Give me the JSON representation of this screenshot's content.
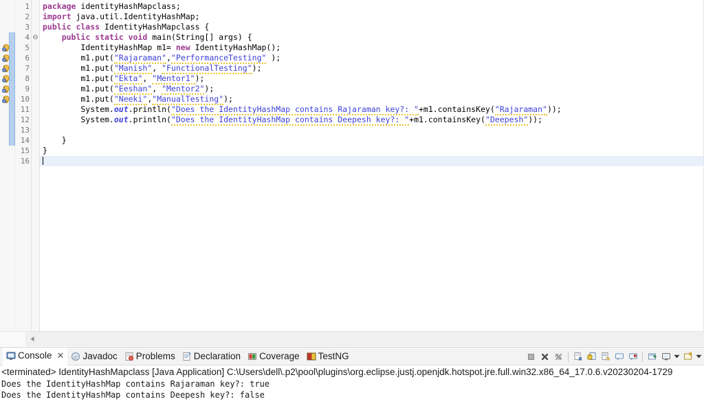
{
  "editor": {
    "lines": [
      {
        "num": "1",
        "fold": "",
        "marker": "none",
        "changed": false,
        "tokens": [
          {
            "t": "kw",
            "s": "package"
          },
          {
            "t": "plain",
            "s": " identityHashMapclass;"
          }
        ]
      },
      {
        "num": "2",
        "fold": "",
        "marker": "none",
        "changed": false,
        "tokens": [
          {
            "t": "kw",
            "s": "import"
          },
          {
            "t": "plain",
            "s": " java.util.IdentityHashMap;"
          }
        ]
      },
      {
        "num": "3",
        "fold": "",
        "marker": "none",
        "changed": false,
        "tokens": [
          {
            "t": "kw",
            "s": "public class"
          },
          {
            "t": "plain",
            "s": " IdentityHashMapclass {"
          }
        ]
      },
      {
        "num": "4",
        "fold": "⊖",
        "marker": "none",
        "changed": true,
        "tokens": [
          {
            "t": "plain",
            "s": "    "
          },
          {
            "t": "kw",
            "s": "public static void"
          },
          {
            "t": "plain",
            "s": " main(String[] args) {"
          }
        ]
      },
      {
        "num": "5",
        "fold": "",
        "marker": "bulb",
        "changed": true,
        "tokens": [
          {
            "t": "plain",
            "s": "        IdentityHashMap m1= "
          },
          {
            "t": "kw",
            "s": "new"
          },
          {
            "t": "plain",
            "s": " IdentityHashMap();"
          }
        ]
      },
      {
        "num": "6",
        "fold": "",
        "marker": "bulb",
        "changed": true,
        "tokens": [
          {
            "t": "plain",
            "s": "        m1.put("
          },
          {
            "t": "str",
            "s": "\"Rajaraman\""
          },
          {
            "t": "plain",
            "s": ","
          },
          {
            "t": "str",
            "s": "\"PerformanceTesting\""
          },
          {
            "t": "plain",
            "s": " );"
          }
        ]
      },
      {
        "num": "7",
        "fold": "",
        "marker": "bulb",
        "changed": true,
        "tokens": [
          {
            "t": "plain",
            "s": "        m1.put("
          },
          {
            "t": "str",
            "s": "\"Manish\""
          },
          {
            "t": "plain",
            "s": ", "
          },
          {
            "t": "str",
            "s": "\"FunctionalTesting\""
          },
          {
            "t": "plain",
            "s": ");"
          }
        ]
      },
      {
        "num": "8",
        "fold": "",
        "marker": "bulb",
        "changed": true,
        "tokens": [
          {
            "t": "plain",
            "s": "        m1.put("
          },
          {
            "t": "str",
            "s": "\"Ekta\""
          },
          {
            "t": "plain",
            "s": ", "
          },
          {
            "t": "str",
            "s": "\"Mentor1\""
          },
          {
            "t": "plain",
            "s": ");"
          }
        ]
      },
      {
        "num": "9",
        "fold": "",
        "marker": "bulb",
        "changed": true,
        "tokens": [
          {
            "t": "plain",
            "s": "        m1.put("
          },
          {
            "t": "str",
            "s": "\"Eeshan\""
          },
          {
            "t": "plain",
            "s": ", "
          },
          {
            "t": "str",
            "s": "\"Mentor2\""
          },
          {
            "t": "plain",
            "s": ");"
          }
        ]
      },
      {
        "num": "10",
        "fold": "",
        "marker": "bulb",
        "changed": true,
        "tokens": [
          {
            "t": "plain",
            "s": "        m1.put("
          },
          {
            "t": "str",
            "s": "\"Neeki\""
          },
          {
            "t": "plain",
            "s": ","
          },
          {
            "t": "str",
            "s": "\"ManualTesting\""
          },
          {
            "t": "plain",
            "s": ");"
          }
        ]
      },
      {
        "num": "11",
        "fold": "",
        "marker": "none",
        "changed": true,
        "tokens": [
          {
            "t": "plain",
            "s": "        System."
          },
          {
            "t": "fld",
            "s": "out"
          },
          {
            "t": "plain",
            "s": ".println("
          },
          {
            "t": "str",
            "s": "\"Does the IdentityHashMap contains Rajaraman key?: \""
          },
          {
            "t": "plain",
            "s": "+m1.containsKey("
          },
          {
            "t": "str",
            "s": "\"Rajaraman\""
          },
          {
            "t": "plain",
            "s": "));"
          }
        ]
      },
      {
        "num": "12",
        "fold": "",
        "marker": "none",
        "changed": true,
        "tokens": [
          {
            "t": "plain",
            "s": "        System."
          },
          {
            "t": "fld",
            "s": "out"
          },
          {
            "t": "plain",
            "s": ".println("
          },
          {
            "t": "str",
            "s": "\"Does the IdentityHashMap contains Deepesh key?: \""
          },
          {
            "t": "plain",
            "s": "+m1.containsKey("
          },
          {
            "t": "str",
            "s": "\"Deepesh\""
          },
          {
            "t": "plain",
            "s": "));"
          }
        ]
      },
      {
        "num": "13",
        "fold": "",
        "marker": "none",
        "changed": true,
        "tokens": [
          {
            "t": "plain",
            "s": ""
          }
        ]
      },
      {
        "num": "14",
        "fold": "",
        "marker": "none",
        "changed": true,
        "tokens": [
          {
            "t": "plain",
            "s": "    }"
          }
        ]
      },
      {
        "num": "15",
        "fold": "",
        "marker": "none",
        "changed": false,
        "tokens": [
          {
            "t": "plain",
            "s": "}"
          }
        ]
      },
      {
        "num": "16",
        "fold": "",
        "marker": "none",
        "changed": false,
        "current": true,
        "tokens": [
          {
            "t": "caret",
            "s": ""
          }
        ]
      }
    ]
  },
  "console": {
    "tabs": [
      {
        "label": "Console",
        "icon": "console-icon",
        "active": true,
        "closable": true,
        "close_glyph": "✕"
      },
      {
        "label": "Javadoc",
        "icon": "javadoc-icon",
        "active": false,
        "closable": false,
        "close_glyph": ""
      },
      {
        "label": "Problems",
        "icon": "problems-icon",
        "active": false,
        "closable": false,
        "close_glyph": ""
      },
      {
        "label": "Declaration",
        "icon": "declaration-icon",
        "active": false,
        "closable": false,
        "close_glyph": ""
      },
      {
        "label": "Coverage",
        "icon": "coverage-icon",
        "active": false,
        "closable": false,
        "close_glyph": ""
      },
      {
        "label": "TestNG",
        "icon": "testng-icon",
        "active": false,
        "closable": false,
        "close_glyph": ""
      }
    ],
    "toolbar": [
      {
        "name": "terminate-button",
        "kind": "icon"
      },
      {
        "name": "remove-launch-button",
        "kind": "icon"
      },
      {
        "name": "remove-all-terminated-button",
        "kind": "icon"
      },
      {
        "name": "separator-1",
        "kind": "sep"
      },
      {
        "name": "clear-console-button",
        "kind": "icon"
      },
      {
        "name": "scroll-lock-button",
        "kind": "icon"
      },
      {
        "name": "word-wrap-button",
        "kind": "icon"
      },
      {
        "name": "show-console-on-output-button",
        "kind": "icon"
      },
      {
        "name": "show-console-on-error-button",
        "kind": "icon"
      },
      {
        "name": "separator-2",
        "kind": "sep"
      },
      {
        "name": "pin-console-button",
        "kind": "icon"
      },
      {
        "name": "display-selected-console-button",
        "kind": "icon"
      },
      {
        "name": "display-console-dropdown",
        "kind": "arrow"
      },
      {
        "name": "open-console-button",
        "kind": "icon"
      },
      {
        "name": "open-console-dropdown",
        "kind": "arrow"
      }
    ],
    "status": "<terminated> IdentityHashMapclass [Java Application] C:\\Users\\dell\\.p2\\pool\\plugins\\org.eclipse.justj.openjdk.hotspot.jre.full.win32.x86_64_17.0.6.v20230204-1729",
    "output": [
      "Does the IdentityHashMap contains Rajaraman key?: true",
      "Does the IdentityHashMap contains Deepesh key?: false"
    ]
  },
  "colors": {
    "keyword": "#9a3a8f",
    "string": "#3c41d8",
    "field": "#3c41d8",
    "current_line_highlight": "#e8f0fb",
    "change_bar": "#a9c7ea",
    "spellcheck_underline": "#e8c52e",
    "panel_background": "#f3f3f3",
    "gutter_background": "#f7f7f7"
  }
}
